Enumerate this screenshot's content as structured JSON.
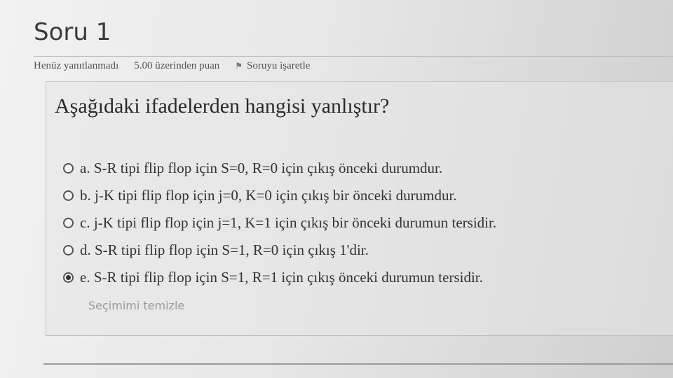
{
  "header": {
    "title": "Soru 1"
  },
  "meta": {
    "status": "Henüz yanıtlanmadı",
    "points": "5.00 üzerinden puan",
    "flag_label": "Soruyu işaretle",
    "flag_icon": "flag-icon"
  },
  "question": {
    "text": "Aşağıdaki ifadelerden hangisi yanlıştır?",
    "options": [
      {
        "label": "a. S-R tipi flip flop için S=0, R=0 için çıkış önceki durumdur.",
        "selected": false
      },
      {
        "label": "b. j-K tipi flip flop için j=0, K=0 için çıkış bir önceki durumdur.",
        "selected": false
      },
      {
        "label": "c. j-K tipi flip flop için j=1, K=1 için çıkış bir önceki durumun tersidir.",
        "selected": false
      },
      {
        "label": "d. S-R tipi flip flop için S=1, R=0 için çıkış 1'dir.",
        "selected": false
      },
      {
        "label": "e. S-R tipi flip flop için S=1, R=1 için çıkış önceki durumun tersidir.",
        "selected": true
      }
    ],
    "clear_label": "Seçimimi temizle"
  }
}
